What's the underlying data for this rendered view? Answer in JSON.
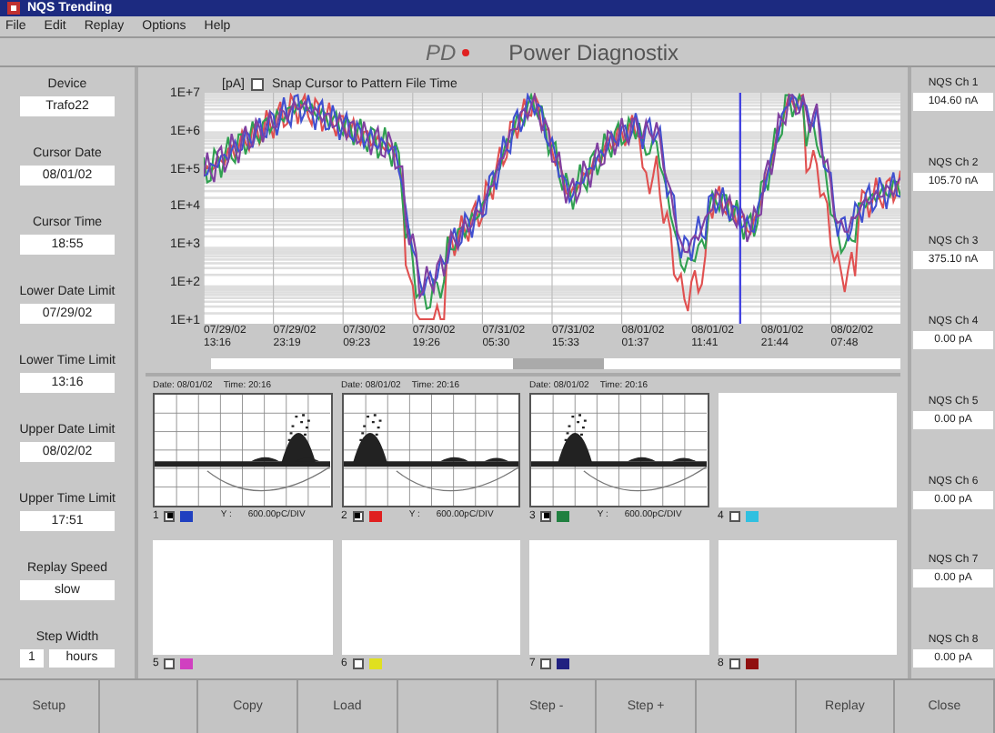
{
  "window": {
    "title": "NQS Trending"
  },
  "menu": [
    "File",
    "Edit",
    "Replay",
    "Options",
    "Help"
  ],
  "header": {
    "logo": "PD",
    "title": "Power Diagnostix"
  },
  "left_fields": [
    {
      "label": "Device",
      "value": "Trafo22"
    },
    {
      "label": "Cursor Date",
      "value": "08/01/02"
    },
    {
      "label": "Cursor Time",
      "value": "18:55"
    },
    {
      "label": "Lower Date Limit",
      "value": "07/29/02"
    },
    {
      "label": "Lower Time Limit",
      "value": "13:16"
    },
    {
      "label": "Upper Date Limit",
      "value": "08/02/02"
    },
    {
      "label": "Upper Time Limit",
      "value": "17:51"
    },
    {
      "label": "Replay Speed",
      "value": "slow"
    },
    {
      "label": "Step Width",
      "value": "1",
      "unit": "hours"
    }
  ],
  "trend": {
    "unit": "[pA]",
    "snap": {
      "label": "Snap Cursor to Pattern File Time",
      "checked": false
    },
    "y_ticks": [
      "1E+7",
      "1E+6",
      "1E+5",
      "1E+4",
      "1E+3",
      "1E+2",
      "1E+1"
    ],
    "x_ticks": [
      [
        "07/29/02",
        "13:16"
      ],
      [
        "07/29/02",
        "23:19"
      ],
      [
        "07/30/02",
        "09:23"
      ],
      [
        "07/30/02",
        "19:26"
      ],
      [
        "07/31/02",
        "05:30"
      ],
      [
        "07/31/02",
        "15:33"
      ],
      [
        "08/01/02",
        "01:37"
      ],
      [
        "08/01/02",
        "11:41"
      ],
      [
        "08/01/02",
        "21:44"
      ],
      [
        "08/02/02",
        "07:48"
      ]
    ]
  },
  "patterns": [
    {
      "number": "1",
      "checked": true,
      "color": "#2040c0",
      "date": "Date: 08/01/02",
      "time": "Time: 20:16",
      "y_label": "Y :",
      "y_value": "600.00pC/DIV",
      "kind": "plot"
    },
    {
      "number": "2",
      "checked": true,
      "color": "#e02020",
      "date": "Date: 08/01/02",
      "time": "Time: 20:16",
      "y_label": "Y :",
      "y_value": "600.00pC/DIV",
      "kind": "plot"
    },
    {
      "number": "3",
      "checked": true,
      "color": "#208040",
      "date": "Date: 08/01/02",
      "time": "Time: 20:16",
      "y_label": "Y :",
      "y_value": "600.00pC/DIV",
      "kind": "plot"
    },
    {
      "number": "4",
      "checked": false,
      "color": "#30c0e0",
      "kind": "empty"
    },
    {
      "number": "5",
      "checked": false,
      "color": "#d040c0",
      "kind": "empty"
    },
    {
      "number": "6",
      "checked": false,
      "color": "#e0e020",
      "kind": "empty"
    },
    {
      "number": "7",
      "checked": false,
      "color": "#202080",
      "kind": "empty"
    },
    {
      "number": "8",
      "checked": false,
      "color": "#901010",
      "kind": "empty"
    }
  ],
  "channels": [
    {
      "label": "NQS Ch 1",
      "value": "104.60 nA"
    },
    {
      "label": "NQS Ch 2",
      "value": "105.70 nA"
    },
    {
      "label": "NQS Ch 3",
      "value": "375.10 nA"
    },
    {
      "label": "NQS Ch 4",
      "value": "0.00 pA"
    },
    {
      "label": "NQS Ch 5",
      "value": "0.00 pA"
    },
    {
      "label": "NQS Ch 6",
      "value": "0.00 pA"
    },
    {
      "label": "NQS Ch 7",
      "value": "0.00 pA"
    },
    {
      "label": "NQS Ch 8",
      "value": "0.00 pA"
    }
  ],
  "buttons": [
    {
      "kind": "labeled",
      "label": "Setup"
    },
    {
      "kind": "blank"
    },
    {
      "kind": "labeled",
      "label": "Copy"
    },
    {
      "kind": "labeled",
      "label": "Load"
    },
    {
      "kind": "blank"
    },
    {
      "kind": "labeled",
      "label": "Step -"
    },
    {
      "kind": "labeled",
      "label": "Step +"
    },
    {
      "kind": "blank"
    },
    {
      "kind": "labeled",
      "label": "Replay"
    },
    {
      "kind": "labeled",
      "label": "Close"
    }
  ]
}
